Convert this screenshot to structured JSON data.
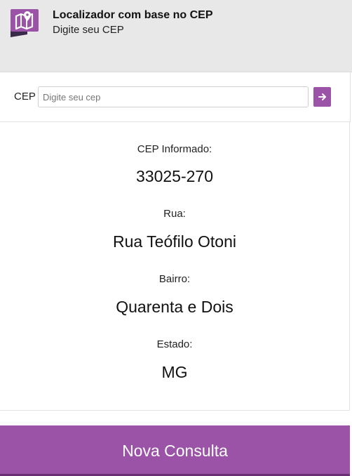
{
  "header": {
    "icon": "map-location-icon",
    "title": "Localizador com base no CEP",
    "subtitle": "Digite seu CEP"
  },
  "search": {
    "label": "CEP",
    "placeholder": "Digite seu cep",
    "value": "",
    "submit_icon": "arrow-right-icon"
  },
  "results": {
    "cep_label": "CEP Informado:",
    "cep_value": "33025-270",
    "street_label": "Rua:",
    "street_value": "Rua Teófilo Otoni",
    "district_label": "Bairro:",
    "district_value": "Quarenta e Dois",
    "state_label": "Estado:",
    "state_value": "MG"
  },
  "actions": {
    "new_search_label": "Nova Consulta"
  },
  "colors": {
    "accent": "#9b53a8",
    "accent_dark": "#6b2f76",
    "header_bg": "#e8e8e8"
  }
}
